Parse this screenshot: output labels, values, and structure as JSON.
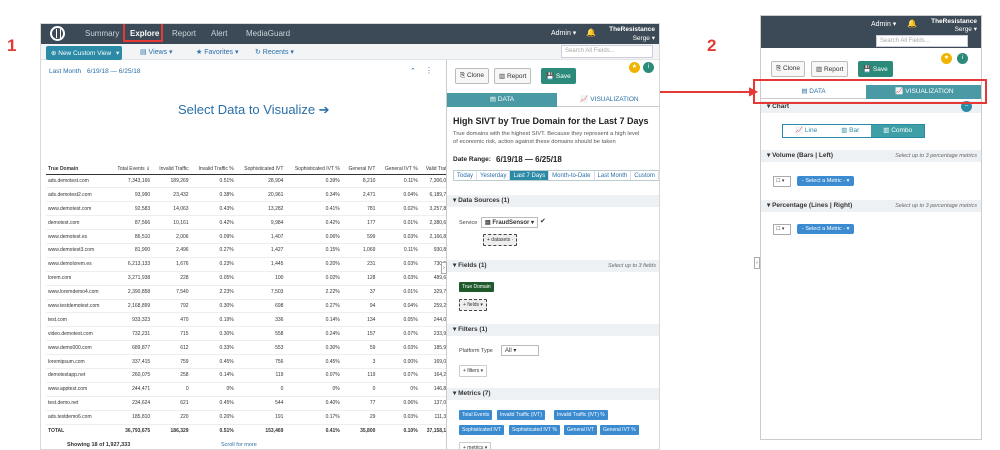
{
  "markers": {
    "one": "1",
    "two": "2"
  },
  "app1": {
    "logo": "logo-icon",
    "nav": [
      "Summary",
      "Explore",
      "Report",
      "Alert",
      "MediaGuard"
    ],
    "active_nav": "Explore",
    "admin": "Admin ▾",
    "org": "TheResistance",
    "user": "Serge ▾",
    "new_view": "⊕ New Custom View",
    "views": "▤ Views ▾",
    "favorites": "★ Favorites ▾",
    "recents": "↻ Recents ▾",
    "search_placeholder": "Search All Fields...",
    "date_label": "Last Month",
    "date_range": "6/19/18 — 6/25/18",
    "cta": "Select Data to Visualize ➔",
    "table": {
      "headers": [
        "True Domain",
        "Total Events ⇓",
        "Invalid Traffic",
        "Invalid Traffic %",
        "Sophisticated IVT",
        "Sophisticated IVT %",
        "General IVT",
        "General IVT %",
        "Valid Traffi"
      ],
      "rows": [
        [
          "ads.demotest.com",
          "7,343,166",
          "189,269",
          "0.51%",
          "28,904",
          "0.39%",
          "8,210",
          "0.11%",
          "7,306,05"
        ],
        [
          "ads.demotest2.com",
          "93,990",
          "23,432",
          "0.38%",
          "20,961",
          "0.34%",
          "2,471",
          "0.04%",
          "6,189,70"
        ],
        [
          "www.demotest.com",
          "92,583",
          "14,063",
          "0.43%",
          "13,282",
          "0.41%",
          "781",
          "0.02%",
          "3,257,87"
        ],
        [
          "demotest.com",
          "87,566",
          "10,161",
          "0.42%",
          "9,984",
          "0.42%",
          "177",
          "0.01%",
          "2,380,65"
        ],
        [
          "www.demotest.es",
          "86,510",
          "2,006",
          "0.09%",
          "1,407",
          "0.06%",
          "599",
          "0.03%",
          "2,166,89"
        ],
        [
          "www.demotest3.com",
          "81,900",
          "2,496",
          "0.27%",
          "1,427",
          "0.15%",
          "1,069",
          "0.11%",
          "930,82"
        ],
        [
          "www.demolorem.es",
          "6,213,133",
          "1,676",
          "0.23%",
          "1,445",
          "0.20%",
          "231",
          "0.03%",
          "730,59"
        ],
        [
          "lorem.com",
          "3,271,938",
          "228",
          "0.05%",
          "100",
          "0.02%",
          "128",
          "0.03%",
          "489,64"
        ],
        [
          "www.loremdemo4.com",
          "2,390,858",
          "7,540",
          "2.23%",
          "7,503",
          "2.22%",
          "37",
          "0.01%",
          "329,77"
        ],
        [
          "www.testdemotest.com",
          "2,168,899",
          "792",
          "0.30%",
          "698",
          "0.27%",
          "94",
          "0.04%",
          "259,25"
        ],
        [
          "test.com",
          "933,323",
          "470",
          "0.19%",
          "336",
          "0.14%",
          "134",
          "0.05%",
          "244,00"
        ],
        [
          "video.demotest.com",
          "732,231",
          "715",
          "0.30%",
          "558",
          "0.24%",
          "157",
          "0.07%",
          "233,97"
        ],
        [
          "www.demo000.com",
          "689,877",
          "612",
          "0.33%",
          "553",
          "0.30%",
          "59",
          "0.03%",
          "185,91"
        ],
        [
          "loremipsum.com",
          "337,415",
          "759",
          "0.45%",
          "756",
          "0.45%",
          "3",
          "0.00%",
          "169,09"
        ],
        [
          "demotestapp.net",
          "260,075",
          "258",
          "0.14%",
          "119",
          "0.07%",
          "119",
          "0.07%",
          "164,22"
        ],
        [
          "www.apptest.com",
          "244,471",
          "0",
          "0%",
          "0",
          "0%",
          "0",
          "0%",
          "146,80"
        ],
        [
          "test.demo.net",
          "234,624",
          "621",
          "0.45%",
          "544",
          "0.40%",
          "77",
          "0.06%",
          "137,09"
        ],
        [
          "ads.testdemo6.com",
          "185,810",
          "220",
          "0.20%",
          "191",
          "0.17%",
          "29",
          "0.03%",
          "111,30"
        ]
      ],
      "total": [
        "TOTAL",
        "36,793,675",
        "186,329",
        "0.51%",
        "153,469",
        "0.41%",
        "35,800",
        "0.10%",
        "37,158,13"
      ]
    },
    "showing": "Showing 18 of 1,927,333",
    "scroll_more": "Scroll for more"
  },
  "panel": {
    "clone": "⎘ Clone",
    "report": "▥ Report",
    "save": "💾 Save",
    "tab_data": "▤ DATA",
    "tab_vis": "📈 VISUALIZATION",
    "title": "High SIVT by True Domain for the Last 7 Days",
    "desc": "True domains with the highest SIVT. Because they represent a high level of economic risk, action against these domains should be taken",
    "date_label": "Date Range:",
    "date_value": "6/19/18 — 6/25/18",
    "quick": [
      "Today",
      "Yesterday",
      "Last 7 Days",
      "Month-to-Date",
      "Last Month",
      "Custom",
      "⋮"
    ],
    "quick_active": "Last 7 Days",
    "data_sources": "▾ Data Sources (1)",
    "service_label": "Service",
    "service_value": "▤ FraudSensor ▾",
    "datasets": "+ datasets ·",
    "fields": "▾ Fields (1)",
    "fields_hint": "Select up to 3 fields",
    "field_chip": "True Domain",
    "fields_add": "+ fields ▾",
    "filters": "▾ Filters (1)",
    "platform_label": "Platform Type",
    "platform_value": "All ▾",
    "filters_add": "+ filters ▾",
    "metrics": "▾ Metrics (7)",
    "metric_chips": [
      "Total Events",
      "Invalid Traffic (IVT)",
      "Invalid Traffic (IVT) %",
      "Sophisticated IVT",
      "Sophisticated IVT %",
      "General IVT",
      "General IVT %"
    ],
    "metrics_add": "+ metrics ▾"
  },
  "app2": {
    "admin": "Admin ▾",
    "org": "TheResistance",
    "user": "Serge ▾",
    "search_placeholder": "Search All Fields...",
    "clone": "⎘ Clone",
    "report": "▥ Report",
    "save": "💾 Save",
    "tab_data": "▤ DATA",
    "tab_vis": "📈 VISUALIZATION",
    "chart_heading": "▾ Chart",
    "chart_types": [
      "📈 Line",
      "▥ Bar",
      "▥ Combo"
    ],
    "chart_active": "▥ Combo",
    "volume": "▾ Volume (Bars | Left)",
    "volume_hint": "Select up to 3 percentage metrics",
    "pct": "▾ Percentage (Lines | Right)",
    "pct_hint": "Select up to 3 percentage metrics",
    "select_metric": "- Select a Metric - ▾",
    "cb": "☐ ▾"
  },
  "accent_colors": {
    "teal": "#2b8aa6",
    "red": "#e53935",
    "nav": "#3c4a57"
  }
}
